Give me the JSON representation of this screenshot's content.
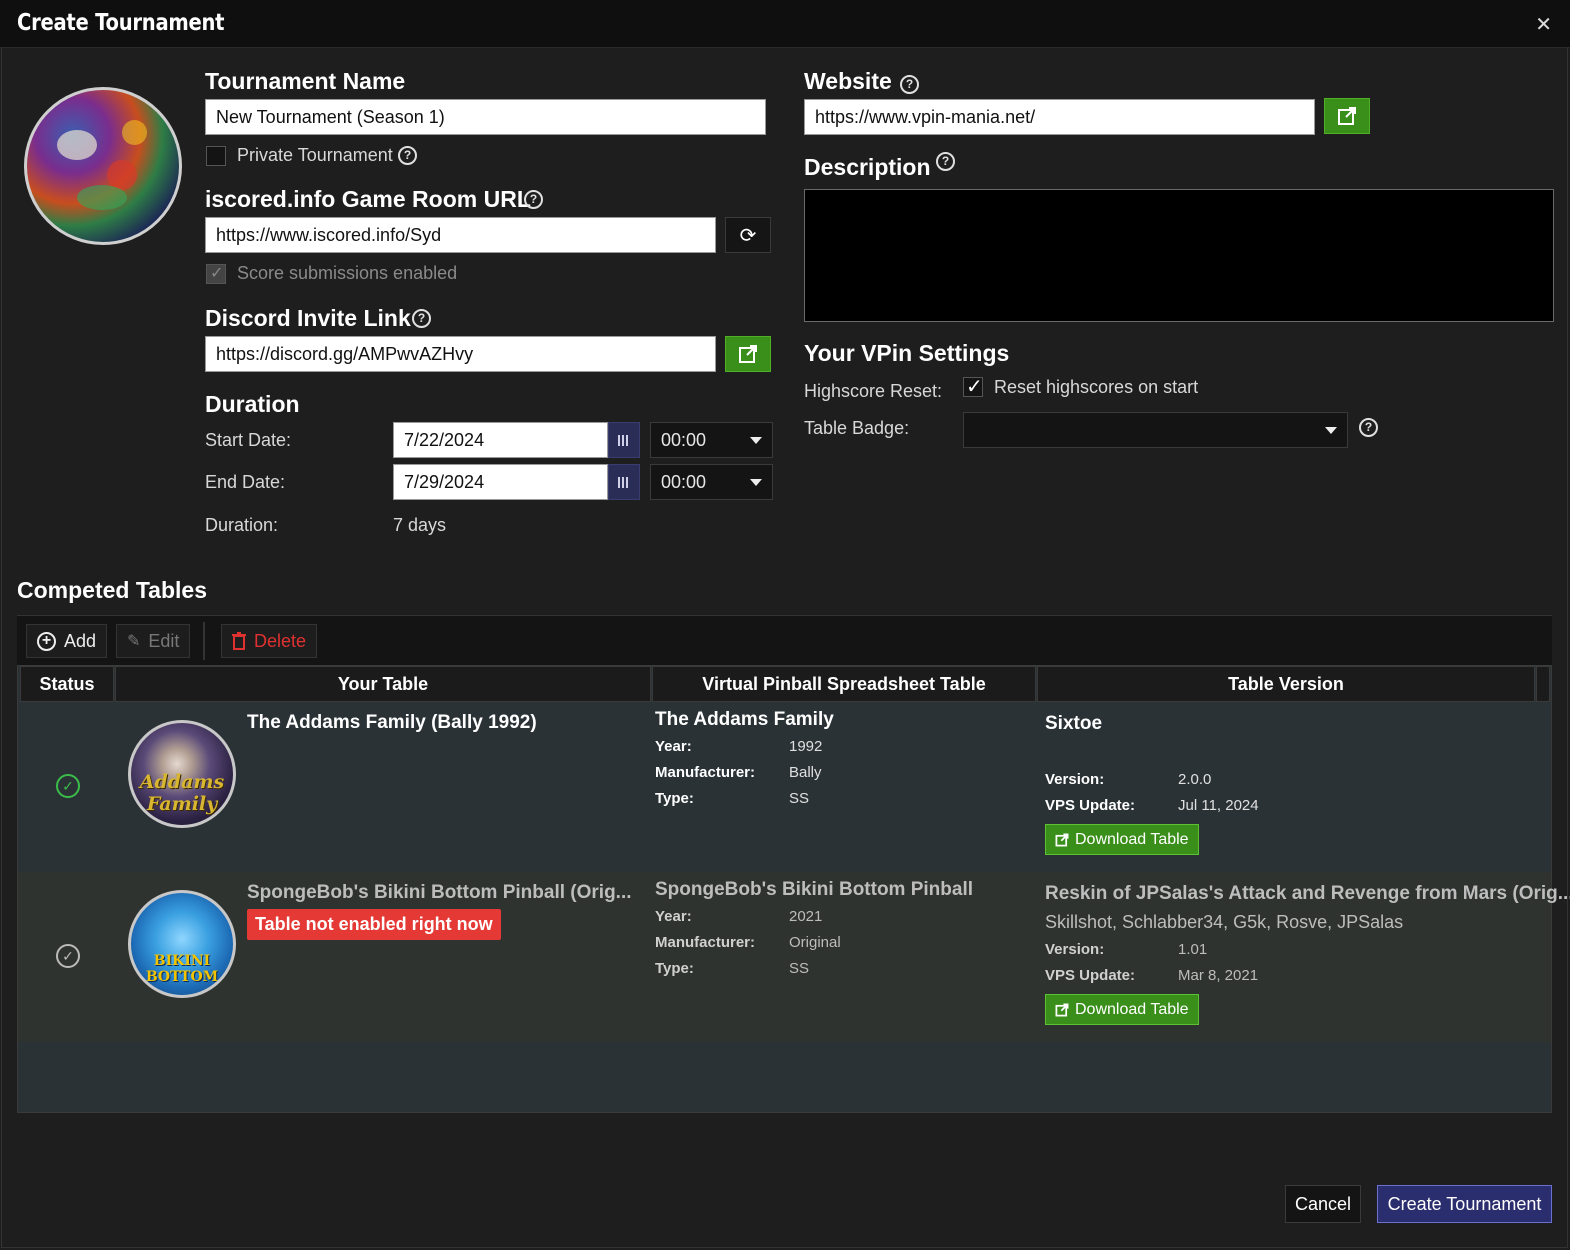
{
  "window": {
    "title": "Create Tournament"
  },
  "tournament": {
    "name_label": "Tournament Name",
    "name_value": "New Tournament (Season 1)",
    "private_label": "Private Tournament",
    "iscored_label": "iscored.info Game Room URL",
    "iscored_value": "https://www.iscored.info/Syd",
    "score_submissions_label": "Score submissions enabled",
    "discord_label": "Discord Invite Link",
    "discord_value": "https://discord.gg/AMPwvAZHvy"
  },
  "duration": {
    "heading": "Duration",
    "start_label": "Start Date:",
    "start_date": "7/22/2024",
    "start_time": "00:00",
    "end_label": "End Date:",
    "end_date": "7/29/2024",
    "end_time": "00:00",
    "duration_label": "Duration:",
    "duration_value": "7 days"
  },
  "website": {
    "label": "Website",
    "value": "https://www.vpin-mania.net/"
  },
  "description": {
    "label": "Description"
  },
  "vpin_settings": {
    "heading": "Your VPin Settings",
    "highscore_reset_label": "Highscore Reset:",
    "reset_checkbox_label": "Reset highscores on start",
    "table_badge_label": "Table Badge:"
  },
  "competed": {
    "heading": "Competed Tables",
    "toolbar": {
      "add": "Add",
      "edit": "Edit",
      "delete": "Delete"
    },
    "columns": [
      "Status",
      "Your Table",
      "Virtual Pinball Spreadsheet Table",
      "Table Version"
    ],
    "rows": [
      {
        "your_table": "The Addams Family (Bally 1992)",
        "wheel_text": "Addams Family",
        "vps_name": "The Addams Family",
        "year_label": "Year:",
        "year": "1992",
        "manufacturer_label": "Manufacturer:",
        "manufacturer": "Bally",
        "type_label": "Type:",
        "type": "SS",
        "version_title": "Sixtoe",
        "version_authors": "",
        "version_label": "Version:",
        "version": "2.0.0",
        "vps_update_label": "VPS Update:",
        "vps_update": "Jul 11, 2024",
        "download": "Download Table"
      },
      {
        "your_table": "SpongeBob's Bikini Bottom Pinball (Orig...",
        "warning": "Table not enabled right now",
        "wheel_text": "BIKINI BOTTOM",
        "vps_name": "SpongeBob's Bikini Bottom Pinball",
        "year_label": "Year:",
        "year": "2021",
        "manufacturer_label": "Manufacturer:",
        "manufacturer": "Original",
        "type_label": "Type:",
        "type": "SS",
        "version_title": "Reskin of  JPSalas's Attack and Revenge from Mars (Orig...",
        "version_authors": "Skillshot, Schlabber34, G5k, Rosve, JPSalas",
        "version_label": "Version:",
        "version": "1.01",
        "vps_update_label": "VPS Update:",
        "vps_update": "Mar 8, 2021",
        "download": "Download Table"
      }
    ]
  },
  "footer": {
    "cancel": "Cancel",
    "create": "Create Tournament"
  },
  "colors": {
    "accent_green": "#3a8f1a",
    "primary_button": "#2a2d6e",
    "warning_red": "#e53935"
  }
}
